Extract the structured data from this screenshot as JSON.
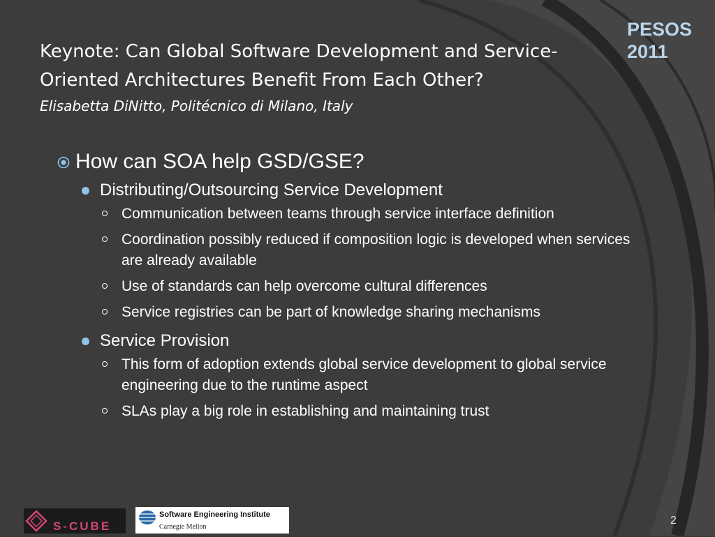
{
  "slide": {
    "conference": {
      "line1": "PESOS",
      "line2": "2011"
    },
    "title": "Keynote: Can Global Software Development and Service-Oriented Architectures Benefit From Each Other?",
    "subtitle": "Elisabetta DiNitto, Politécnico di Milano, Italy",
    "bullets": {
      "heading": "How can SOA help GSD/GSE?",
      "groups": [
        {
          "label": "Distributing/Outsourcing Service Development",
          "items": [
            "Communication between teams through service interface definition",
            "Coordination possibly reduced if composition logic is developed when services are already available",
            "Use of standards can help overcome cultural differences",
            "Service registries can be part of knowledge sharing mechanisms"
          ]
        },
        {
          "label": "Service Provision",
          "items": [
            "This form of adoption extends global service development to global service engineering due to the runtime aspect",
            "SLAs play a big role in establishing and maintaining trust"
          ]
        }
      ]
    },
    "footer": {
      "logo_scube_text": "S-CUBE",
      "logo_sei_name": "Software Engineering Institute",
      "logo_sei_sub": "Carnegie Mellon",
      "page_number": "2"
    }
  },
  "colors": {
    "background": "#3a3a3a",
    "arc": "#2a2a2a",
    "accent": "#b8d4ea",
    "bullet": "#8fc3e8"
  }
}
